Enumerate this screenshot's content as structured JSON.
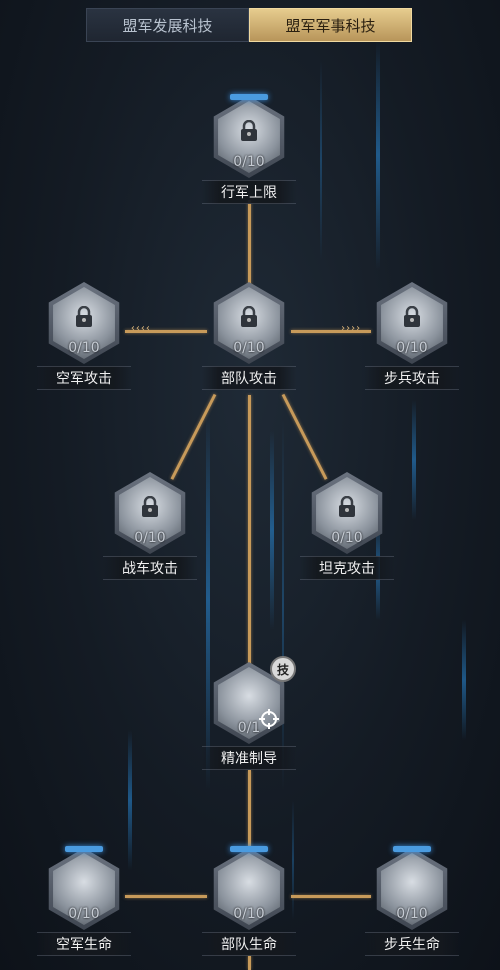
{
  "tabs": [
    {
      "label": "盟军发展科技",
      "active": false
    },
    {
      "label": "盟军军事科技",
      "active": true
    }
  ],
  "nodes": {
    "march_limit": {
      "name": "行军上限",
      "progress": "0/10"
    },
    "air_attack": {
      "name": "空军攻击",
      "progress": "0/10"
    },
    "troop_attack": {
      "name": "部队攻击",
      "progress": "0/10"
    },
    "infantry_attack": {
      "name": "步兵攻击",
      "progress": "0/10"
    },
    "chariot_attack": {
      "name": "战车攻击",
      "progress": "0/10"
    },
    "tank_attack": {
      "name": "坦克攻击",
      "progress": "0/10"
    },
    "precision_guidance": {
      "name": "精准制导",
      "progress": "0/1",
      "badge": "技"
    },
    "air_health": {
      "name": "空军生命",
      "progress": "0/10"
    },
    "troop_health": {
      "name": "部队生命",
      "progress": "0/10"
    },
    "infantry_health": {
      "name": "步兵生命",
      "progress": "0/10"
    }
  },
  "colors": {
    "accent": "#c79a5a",
    "tab_active": "#d8bb7a",
    "cap_blue": "#4a9be0"
  }
}
